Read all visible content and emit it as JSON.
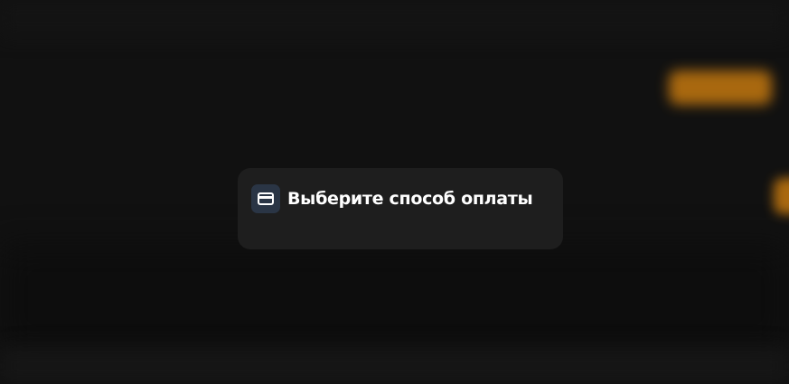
{
  "modal": {
    "icon": "credit-card-icon",
    "title": "Выберите способ оплаты"
  },
  "colors": {
    "background": "#111111",
    "modal_background": "#1e1e1e",
    "icon_background": "#2a3545",
    "accent": "#c4780f",
    "title_text": "#ffffff"
  }
}
